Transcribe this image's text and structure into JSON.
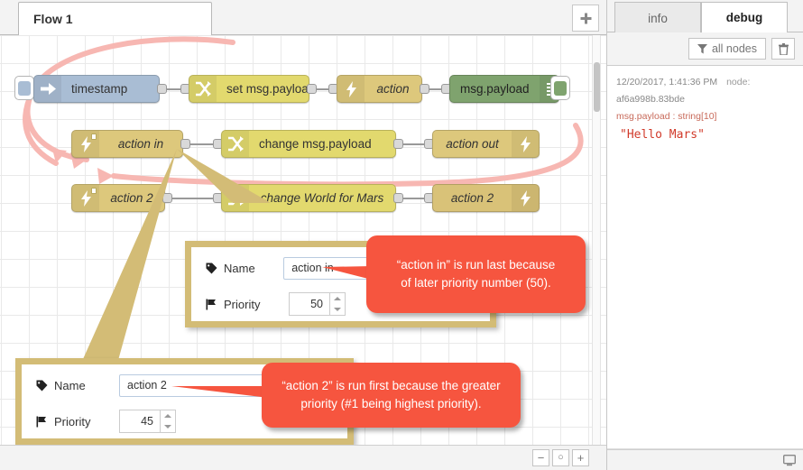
{
  "app": {
    "tab_label": "Flow 1",
    "add_tab_icon": "plus-icon"
  },
  "canvas": {
    "rows": [
      {
        "id": "row1",
        "nodes": [
          {
            "name": "inject-node",
            "label": "timestamp",
            "icon": "arrow-right-icon",
            "color": "#a9bdd4"
          },
          {
            "name": "change-node",
            "label": "set msg.payload",
            "icon": "shuffle-icon",
            "color": "#e2d96e"
          },
          {
            "name": "action-node",
            "label": "action",
            "icon": "bolt-icon",
            "color": "#ddc87c"
          },
          {
            "name": "debug-node",
            "label": "msg.payload",
            "icon": "bars-icon",
            "color": "#7fa36e"
          }
        ]
      },
      {
        "id": "row2",
        "nodes": [
          {
            "name": "action-in-node",
            "label": "action in",
            "icon": "bolt-icon",
            "color": "#ddc87c"
          },
          {
            "name": "change-payload-node",
            "label": "change msg.payload",
            "icon": "shuffle-icon",
            "color": "#e2d96e"
          },
          {
            "name": "action-out-node",
            "label": "action out",
            "icon": "bolt-icon",
            "color": "#ddc87c"
          }
        ]
      },
      {
        "id": "row3",
        "nodes": [
          {
            "name": "action-2-in-node",
            "label": "action 2",
            "icon": "bolt-icon",
            "color": "#ddc87c"
          },
          {
            "name": "change-world-node",
            "label": "change World for Mars",
            "icon": "shuffle-icon",
            "color": "#e2d96e"
          },
          {
            "name": "action-2-out-node",
            "label": "action 2",
            "icon": "bolt-icon",
            "color": "#d9c278"
          }
        ]
      }
    ]
  },
  "dialogs": [
    {
      "id": "dialog-action-in",
      "name_label": "Name",
      "name_value": "action in",
      "priority_label": "Priority",
      "priority_value": "50",
      "name_icon": "tag-icon",
      "priority_icon": "flag-icon"
    },
    {
      "id": "dialog-action-2",
      "name_label": "Name",
      "name_value": "action 2",
      "priority_label": "Priority",
      "priority_value": "45",
      "name_icon": "tag-icon",
      "priority_icon": "flag-icon"
    }
  ],
  "callouts": [
    {
      "id": "callout-action-in",
      "line1": "“action in” is run last because",
      "line2": "of later priority number (50).",
      "color": "#f6553f"
    },
    {
      "id": "callout-action-2",
      "line1": "“action 2” is run first because the greater",
      "line2": "priority (#1 being highest priority).",
      "color": "#f6553f"
    }
  ],
  "zoombar": {
    "zoom_out": "−",
    "zoom_reset": "○",
    "zoom_in": "+"
  },
  "sidebar": {
    "tabs": [
      {
        "label": "info",
        "active": false
      },
      {
        "label": "debug",
        "active": true
      }
    ],
    "toolbar": {
      "filter_label": "all nodes",
      "filter_icon": "funnel-icon",
      "clear_icon": "trash-icon"
    },
    "debug_messages": [
      {
        "timestamp": "12/20/2017, 1:41:36 PM",
        "node_keyword": "node:",
        "node_id": "af6a998b.83bde",
        "property": "msg.payload : string[10]",
        "value": "\"Hello Mars\""
      }
    ],
    "footer_icon": "monitor-icon"
  }
}
